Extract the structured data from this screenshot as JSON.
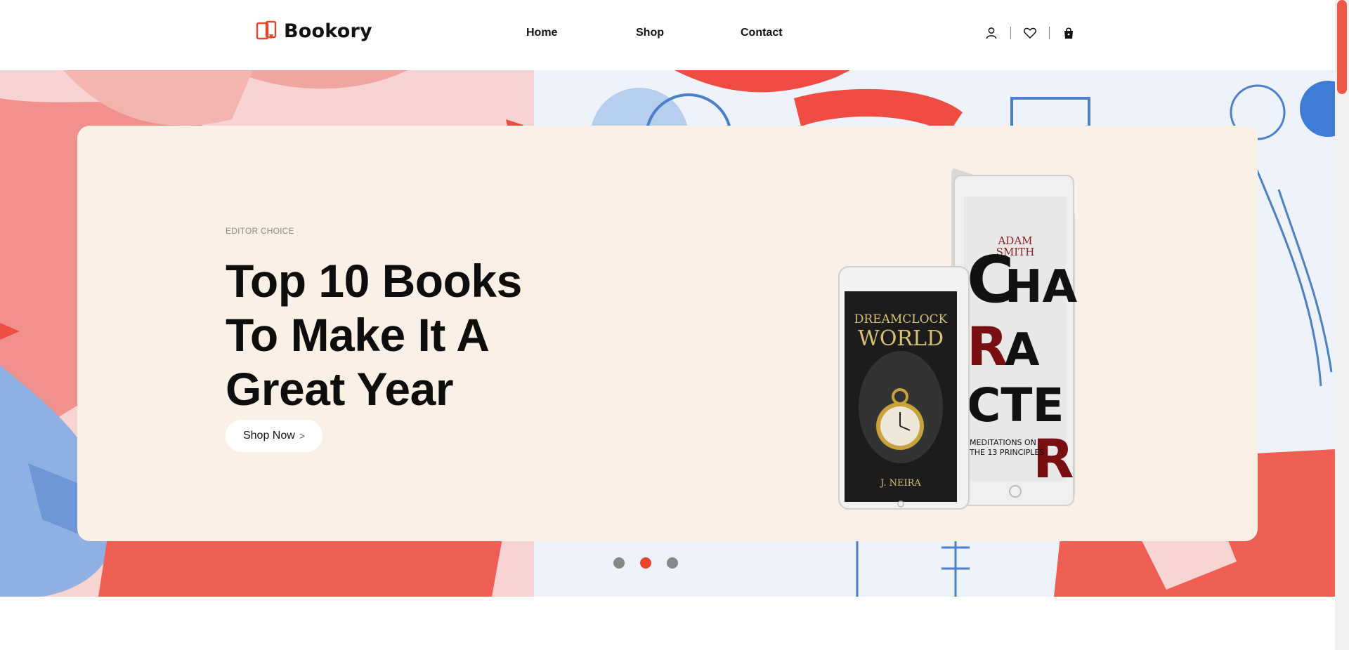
{
  "brand": {
    "name": "Bookory",
    "accent": "#e8452f"
  },
  "nav": {
    "items": [
      {
        "label": "Home"
      },
      {
        "label": "Shop"
      },
      {
        "label": "Contact"
      }
    ]
  },
  "header_icons": [
    "user-icon",
    "heart-icon",
    "bag-icon"
  ],
  "hero": {
    "eyebrow": "EDITOR CHOICE",
    "headline_lines": [
      "Top 10 Books",
      "To Make It A",
      "Great Year"
    ],
    "cta_label": "Shop Now",
    "cta_chevron": ">",
    "card_color": "#fbf0e6",
    "slides": {
      "count": 3,
      "active": 2
    }
  },
  "book_covers": {
    "small": {
      "title_1": "DREAMCLOCK",
      "title_2": "WORLD",
      "author": "J. NEIRA"
    },
    "large": {
      "author_1": "ADAM",
      "author_2": "SMITH",
      "title": "CHARACTER",
      "subtitle_1": "MEDITATIONS ON",
      "subtitle_2": "THE 13 PRINCIPLES"
    }
  }
}
